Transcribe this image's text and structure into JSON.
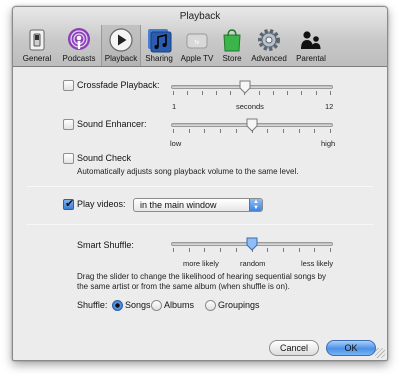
{
  "window": {
    "title": "Playback"
  },
  "toolbar": [
    {
      "label": "General",
      "icon": "general-switch-icon"
    },
    {
      "label": "Podcasts",
      "icon": "podcast-icon"
    },
    {
      "label": "Playback",
      "icon": "play-icon",
      "selected": true
    },
    {
      "label": "Sharing",
      "icon": "sharing-music-icon"
    },
    {
      "label": "Apple TV",
      "icon": "apple-tv-icon"
    },
    {
      "label": "Store",
      "icon": "store-bag-icon"
    },
    {
      "label": "Advanced",
      "icon": "gear-icon"
    },
    {
      "label": "Parental",
      "icon": "parental-people-icon"
    }
  ],
  "crossfade": {
    "label": "Crossfade Playback:",
    "checked": false,
    "min_label": "1",
    "mid_label": "seconds",
    "max_label": "12",
    "slider_fraction": 0.46
  },
  "sound_enhancer": {
    "label": "Sound Enhancer:",
    "checked": false,
    "min_label": "low",
    "max_label": "high",
    "slider_fraction": 0.5
  },
  "sound_check": {
    "label": "Sound Check",
    "checked": false,
    "description": "Automatically adjusts song playback volume to the same level."
  },
  "play_videos": {
    "label": "Play videos:",
    "checked": true,
    "selected_option": "in the main window"
  },
  "smart_shuffle": {
    "label": "Smart Shuffle:",
    "min_label": "more likely",
    "mid_label": "random",
    "max_label": "less likely",
    "slider_fraction": 0.5,
    "description_line1": "Drag the slider to change the likelihood of hearing sequential songs by",
    "description_line2": "the same artist or from the same album (when shuffle is on)."
  },
  "shuffle": {
    "label": "Shuffle:",
    "options": [
      {
        "label": "Songs",
        "selected": true
      },
      {
        "label": "Albums",
        "selected": false
      },
      {
        "label": "Groupings",
        "selected": false
      }
    ]
  },
  "buttons": {
    "cancel": "Cancel",
    "ok": "OK"
  },
  "colors": {
    "accent": "#3e83dd",
    "window_bg": "#ececec"
  }
}
